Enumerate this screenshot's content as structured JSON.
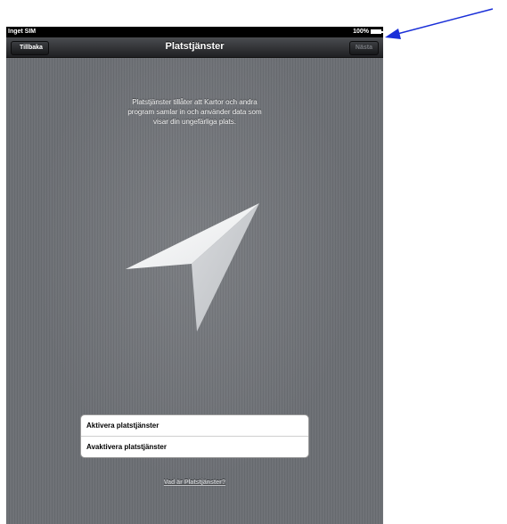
{
  "status_bar": {
    "carrier": "Inget SIM",
    "battery": "100%"
  },
  "nav_bar": {
    "back_label": "Tillbaka",
    "title": "Platstjänster",
    "next_label": "Nästa"
  },
  "main": {
    "description": "Platstjänster tillåter att Kartor och andra program samlar in och använder data som visar din ungefärliga plats.",
    "options": [
      {
        "label": "Aktivera platstjänster"
      },
      {
        "label": "Avaktivera platstjänster"
      }
    ],
    "help_link": "Vad är Platstjänster?"
  },
  "colors": {
    "background": "#6c6f74",
    "annotation_arrow": "#1a2fd8"
  },
  "icons": {
    "main": "location-arrow-icon",
    "annotation": "annotation-arrow"
  }
}
